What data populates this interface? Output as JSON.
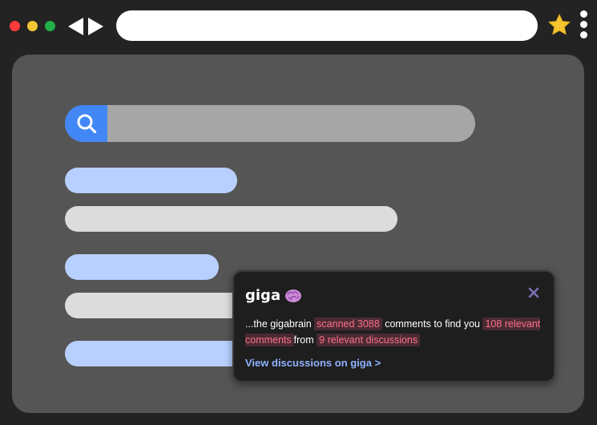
{
  "window": {
    "controls": [
      "close-dot",
      "minimize-dot",
      "maximize-dot"
    ],
    "nav_icons": [
      "back-arrow-icon",
      "forward-arrow-icon"
    ],
    "address": "",
    "bookmark_icon": "star-icon",
    "menu_icon": "kebab-menu-icon"
  },
  "colors": {
    "accent_blue": "#4287f5",
    "highlight_pink": "#ff6f8a",
    "link_blue": "#8fb2ff",
    "star_yellow": "#f7c530"
  },
  "search": {
    "icon": "search-icon"
  },
  "popup": {
    "title": "giga",
    "title_icon": "brain-icon",
    "close_icon": "close-icon",
    "text_intro": "...the gigabrain ",
    "scanned": "scanned 3088",
    "text_mid": " comments to find you ",
    "relevant_comments": "108 relevant comments",
    "text_from": "from ",
    "relevant_discussions": "9 relevant discussions",
    "link": "View discussions on giga >"
  }
}
